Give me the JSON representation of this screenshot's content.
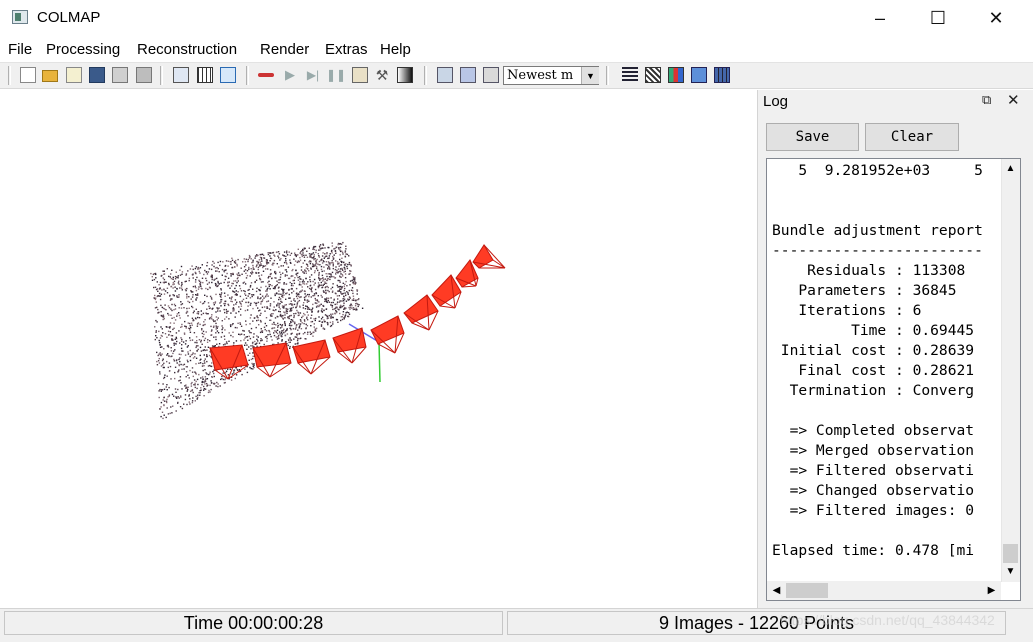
{
  "window": {
    "title": "COLMAP",
    "minimize": "–",
    "maximize": "☐",
    "close": "✕"
  },
  "menu": [
    "File",
    "Processing",
    "Reconstruction",
    "Render",
    "Extras",
    "Help"
  ],
  "toolbar": {
    "icons": [
      "new-project-icon",
      "open-project-icon",
      "edit-project-icon",
      "save-project-icon",
      "import-model-icon",
      "export-model-icon",
      "feature-extraction-icon",
      "feature-matching-icon",
      "database-icon",
      "reconstruction-start-icon",
      "reconstruction-step-icon",
      "reconstruction-pause-icon",
      "reconstruction-reset-icon",
      "bundle-adjustment-icon",
      "dense-reconstruction-icon",
      "render-options-icon",
      "reset-view-icon",
      "project-zoom-icon",
      "render-icon",
      "camera-icon",
      "log-icon",
      "match-matrix-icon",
      "statistics-icon",
      "screenshot-icon",
      "video-icon"
    ],
    "combo_value": "Newest m",
    "colors": {
      "play": "#4a8a4a",
      "record": "#cc3333"
    }
  },
  "log": {
    "title": "Log",
    "save_label": "Save",
    "clear_label": "Clear",
    "lines": [
      "   5  9.281952e+03     5",
      "",
      "",
      "Bundle adjustment report",
      "------------------------",
      "    Residuals : 113308",
      "   Parameters : 36845",
      "   Iterations : 6",
      "         Time : 0.69445",
      " Initial cost : 0.28639",
      "   Final cost : 0.28621",
      "  Termination : Converg",
      "",
      "  => Completed observat",
      "  => Merged observation",
      "  => Filtered observati",
      "  => Changed observatio",
      "  => Filtered images: 0",
      "",
      "Elapsed time: 0.478 [mi"
    ]
  },
  "status": {
    "time": "Time 00:00:00:28",
    "summary": "9 Images - 12260 Points",
    "watermark": "https://blog.csdn.net/qq_43844342"
  },
  "scene": {
    "camera_color": "#ff3b24",
    "camera_edge": "#c41a10",
    "point_colors": [
      "#3c2c3a",
      "#5a4552",
      "#2a2030",
      "#7a6470",
      "#4a3640",
      "#8a7078"
    ],
    "axis_colors": {
      "x": "#e06060",
      "y": "#33cc33",
      "z": "#6666ee"
    }
  }
}
